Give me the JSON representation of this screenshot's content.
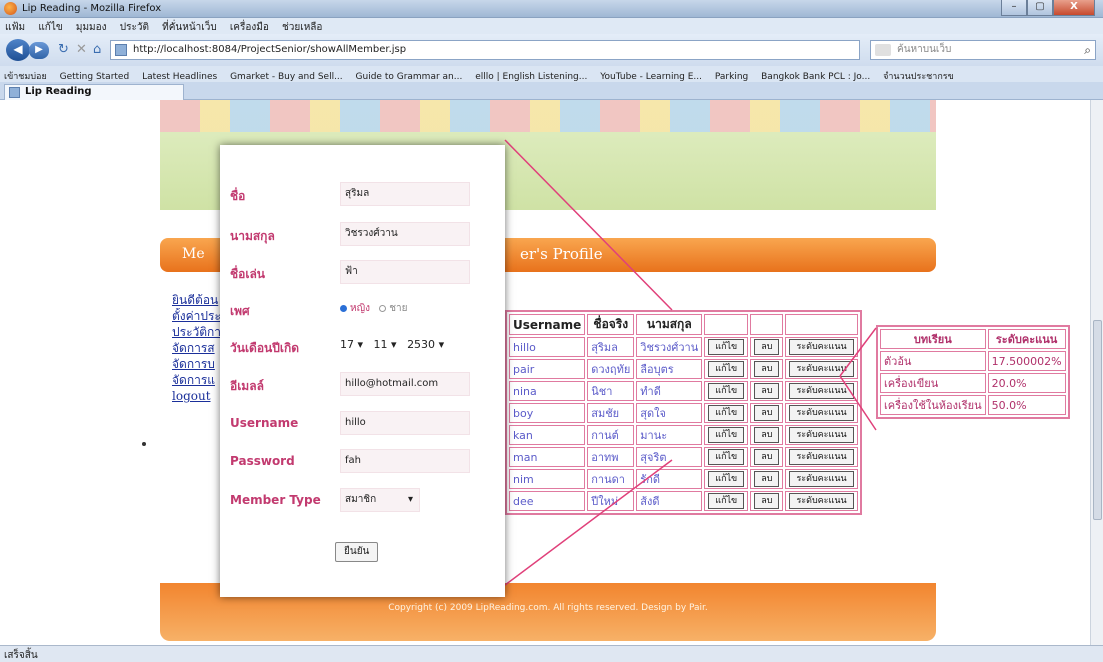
{
  "window": {
    "title": "Lip Reading - Mozilla Firefox",
    "controls": [
      "–",
      "▢",
      "X"
    ]
  },
  "menu": [
    "แฟ้ม",
    "แก้ไข",
    "มุมมอง",
    "ประวัติ",
    "ที่คั่นหน้าเว็บ",
    "เครื่องมือ",
    "ช่วยเหลือ"
  ],
  "nav": {
    "url": "http://localhost:8084/ProjectSenior/showAllMember.jsp",
    "search_placeholder": "ค้นหาบนเว็บ"
  },
  "bookmarks": [
    "เข้าชมบ่อย",
    "Getting Started",
    "Latest Headlines",
    "Gmarket - Buy and Sell...",
    "Guide to Grammar an...",
    "elllo | English Listening...",
    "YouTube - Learning E...",
    "Parking",
    "Bangkok Bank PCL : Jo...",
    "จำนวนประชากรข"
  ],
  "tab": {
    "label": "Lip Reading"
  },
  "page": {
    "left_title": "Me",
    "right_title": "er's Profile",
    "side_links": [
      "ยินดีต้อน",
      "ตั้งค่าประ",
      "ประวัติกา",
      "จัดการส",
      "จัดการบ",
      "จัดการแ",
      "logout"
    ],
    "footer": "Copyright (c) 2009 LipReading.com. All rights reserved. Design by Pair."
  },
  "members_table": {
    "headers": [
      "Username",
      "ชื่อจริง",
      "นามสกุล"
    ],
    "rows": [
      [
        "hillo",
        "สุริมล",
        "วิชรวงศ์วาน"
      ],
      [
        "pair",
        "ดวงฤทัย",
        "ลือบุตร"
      ],
      [
        "nina",
        "นิชา",
        "ทำดี"
      ],
      [
        "boy",
        "สมชัย",
        "สุดใจ"
      ],
      [
        "kan",
        "กานต์",
        "มานะ"
      ],
      [
        "man",
        "อาทพ",
        "สุจริต"
      ],
      [
        "nim",
        "กานดา",
        "รักดี"
      ],
      [
        "dee",
        "ปีใหม่",
        "ส้งดี"
      ]
    ],
    "edit_label": "แก้ไข",
    "delete_label": "ลบ",
    "score_label": "ระดับคะแนน"
  },
  "scores_table": {
    "headers": [
      "บทเรียน",
      "ระดับคะแนน"
    ],
    "rows": [
      [
        "ตัวอ้น",
        "17.500002%"
      ],
      [
        "เครื่องเขียน",
        "20.0%"
      ],
      [
        "เครื่องใช้ในห้องเรียน",
        "50.0%"
      ]
    ]
  },
  "form": {
    "first_name": {
      "label": "ชื่อ",
      "value": "สุริมล"
    },
    "last_name": {
      "label": "นามสกุล",
      "value": "วิชรวงศ์วาน"
    },
    "nickname": {
      "label": "ชื่อเล่น",
      "value": "ฟ้า"
    },
    "gender": {
      "label": "เพศ",
      "female": "หญิง",
      "male": "ชาย",
      "selected": "หญิง"
    },
    "birthdate": {
      "label": "วันเดือนปีเกิด",
      "day": "17",
      "month": "11",
      "year": "2530"
    },
    "email": {
      "label": "อีเมลล์",
      "value": "hillo@hotmail.com"
    },
    "username": {
      "label": "Username",
      "value": "hillo"
    },
    "password": {
      "label": "Password",
      "value": "fah"
    },
    "member_type": {
      "label": "Member Type",
      "value": "สมาชิก"
    },
    "confirm": "ยืนยัน"
  },
  "status": "เสร็จสิ้น",
  "colors": {
    "accent_pink": "#c23a6f",
    "table_border": "#e07aa0",
    "orange": "#f08a36"
  }
}
